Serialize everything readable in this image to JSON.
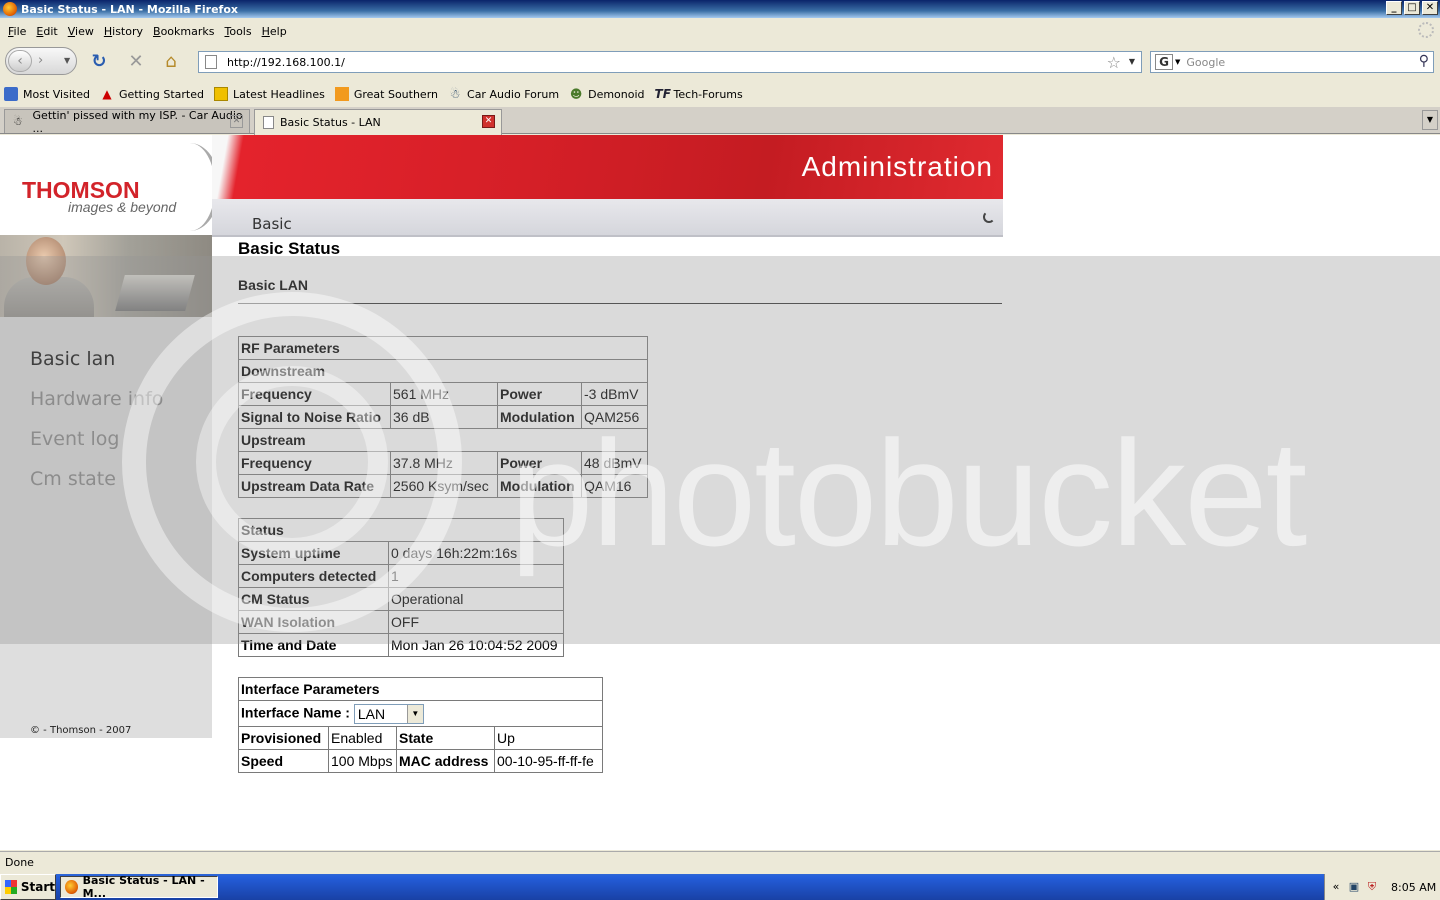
{
  "window": {
    "title": "Basic Status - LAN - Mozilla Firefox",
    "min": "_",
    "max": "□",
    "close": "✕"
  },
  "menu": [
    "File",
    "Edit",
    "View",
    "History",
    "Bookmarks",
    "Tools",
    "Help"
  ],
  "nav": {
    "url": "http://192.168.100.1/",
    "search_placeholder": "Google",
    "search_engine": "G"
  },
  "bookmarks": [
    {
      "label": "Most Visited",
      "icon": "bookmark-folder-icon"
    },
    {
      "label": "Getting Started",
      "icon": "firefox-red-icon"
    },
    {
      "label": "Latest Headlines",
      "icon": "rss-feed-icon"
    },
    {
      "label": "Great Southern",
      "icon": "orange-square-icon"
    },
    {
      "label": "Car Audio Forum",
      "icon": "car-audio-icon"
    },
    {
      "label": "Demonoid",
      "icon": "demonoid-icon"
    },
    {
      "label": "Tech-Forums",
      "icon": "tf-icon"
    }
  ],
  "tabs": [
    {
      "label": "Gettin' pissed with my ISP. - Car Audio ..."
    },
    {
      "label": "Basic Status - LAN"
    }
  ],
  "page": {
    "logo": "THOMSON",
    "tagline": "images & beyond",
    "banner_title": "Administration",
    "subnav": "Basic",
    "sidebar": [
      "Basic lan",
      "Hardware info",
      "Event log",
      "Cm state"
    ],
    "copyright": "© - Thomson - 2007",
    "heading": "Basic Status",
    "subheading": "Basic LAN"
  },
  "rf": {
    "title": "RF Parameters",
    "downstream": "Downstream",
    "upstream": "Upstream",
    "ds_freq_label": "Frequency",
    "ds_freq": "561 MHz",
    "ds_power_label": "Power",
    "ds_power": "-3 dBmV",
    "snr_label": "Signal to Noise Ratio",
    "snr": "36 dB",
    "mod_label": "Modulation",
    "mod": "QAM256",
    "us_freq_label": "Frequency",
    "us_freq": "37.8 MHz",
    "us_power_label": "Power",
    "us_power": "48 dBmV",
    "us_rate_label": "Upstream Data Rate",
    "us_rate": "2560 Ksym/sec",
    "us_mod_label": "Modulation",
    "us_mod": "QAM16"
  },
  "status": {
    "title": "Status",
    "rows": [
      {
        "label": "System uptime",
        "value": "0 days 16h:22m:16s"
      },
      {
        "label": "Computers detected",
        "value": "1"
      },
      {
        "label": "CM Status",
        "value": "Operational"
      },
      {
        "label": "WAN Isolation",
        "value": "OFF"
      },
      {
        "label": "Time and Date",
        "value": "Mon Jan 26 10:04:52 2009"
      }
    ]
  },
  "iface": {
    "title": "Interface Parameters",
    "name_label": "Interface Name :",
    "name_value": "LAN",
    "prov_label": "Provisioned",
    "prov": "Enabled",
    "state_label": "State",
    "state": "Up",
    "speed_label": "Speed",
    "speed": "100 Mbps",
    "mac_label": "MAC address",
    "mac": "00-10-95-ff-ff-fe"
  },
  "watermark": "photobucket",
  "statusbar": "Done",
  "taskbar": {
    "start": "Start",
    "item": "Basic Status - LAN - M...",
    "clock": "8:05 AM",
    "tray_arrow": "«"
  }
}
